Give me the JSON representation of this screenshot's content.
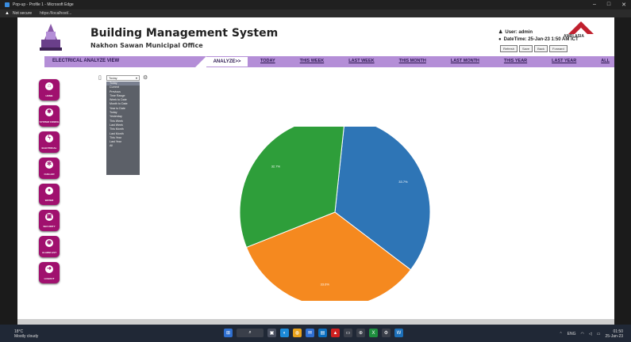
{
  "browser": {
    "title": "Pop-up - Profile 1 - Microsoft Edge",
    "not_secure": "Not secure",
    "url": "https://localhost/..."
  },
  "header": {
    "title": "Building Management System",
    "subtitle": "Nakhon Sawan Municipal Office",
    "user_line": "User: admin",
    "datetime_line": "DateTime: 25-Jan-23 1:50 AM ICT",
    "brand": "AMRI ASIA",
    "buttons": [
      "Refresh",
      "Save",
      "Back",
      "Forward"
    ]
  },
  "navbar": {
    "view_label": "ELECTRICAL ANALYZE VIEW",
    "analyze": "ANALYZE>>",
    "links": [
      "TODAY",
      "THIS WEEK",
      "LAST WEEK",
      "THIS MONTH",
      "LAST MONTH",
      "THIS YEAR",
      "LAST YEAR",
      "ALL"
    ]
  },
  "sidebar": [
    "HOME",
    "SYSTEM CONFIG",
    "ELECTRICAL",
    "CHILLER",
    "WATER",
    "SECURITY",
    "ALARM LIST",
    "LOGOUT"
  ],
  "dropdown": {
    "selected": "Today",
    "items": [
      "Today",
      "Current",
      "Previous",
      "Time Range",
      "Week to Date",
      "Month to Date",
      "Year to Date",
      "Today",
      "Yesterday",
      "This Week",
      "Last Week",
      "This Month",
      "Last Month",
      "This Year",
      "Last Year",
      "All"
    ]
  },
  "chart_data": {
    "type": "pie",
    "slices": [
      {
        "label": "33.7%",
        "value": 33.7,
        "color": "#2e75b6"
      },
      {
        "label": "33.6%",
        "value": 33.6,
        "color": "#f5891f"
      },
      {
        "label": "32.7%",
        "value": 32.7,
        "color": "#2e9e3a"
      }
    ]
  },
  "taskbar": {
    "weather_temp": "18°C",
    "weather_desc": "Mostly cloudy",
    "lang": "ENG",
    "time": "01:50",
    "date": "25-Jan-23"
  }
}
